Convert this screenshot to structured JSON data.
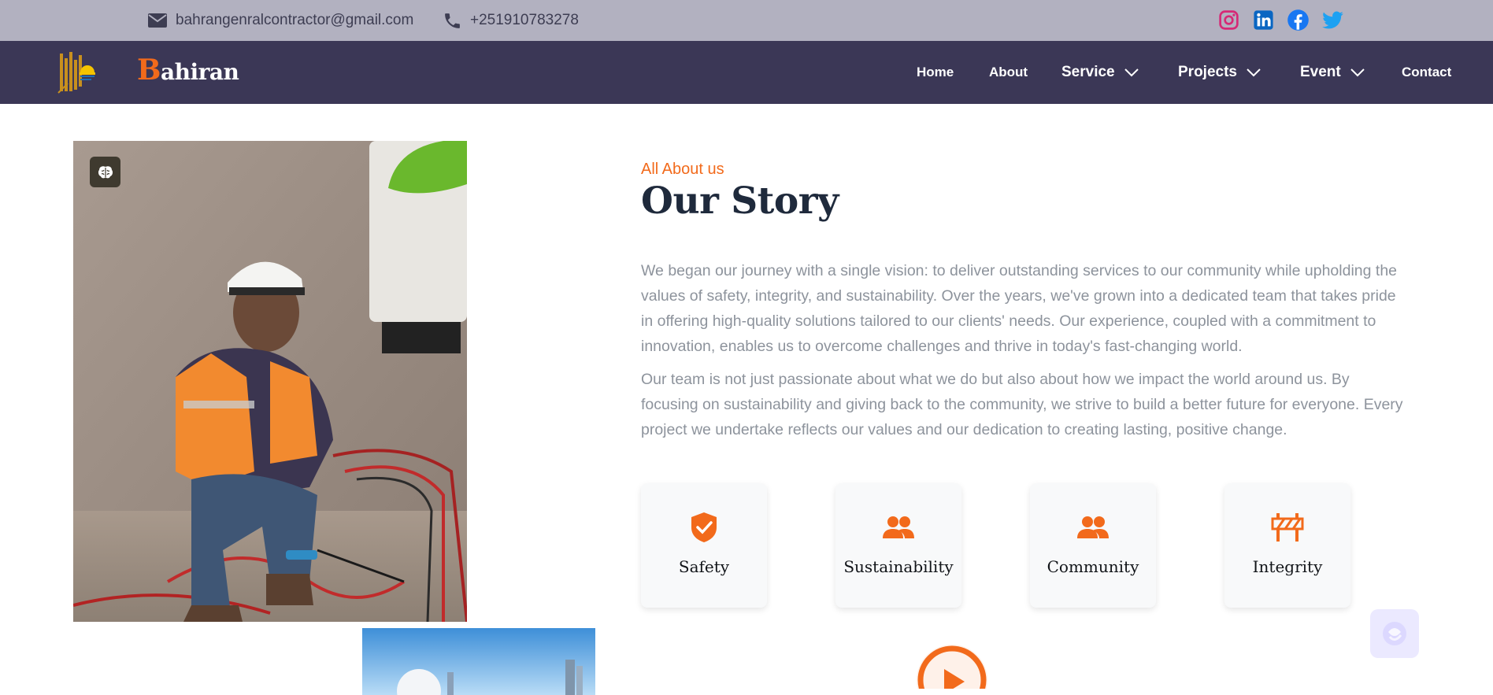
{
  "topbar": {
    "email": "bahrangenralcontractor@gmail.com",
    "phone": "+251910783278",
    "email_icon": "envelope-icon",
    "phone_icon": "phone-icon",
    "socials": [
      "instagram-icon",
      "linkedin-icon",
      "facebook-icon",
      "twitter-icon"
    ]
  },
  "nav": {
    "brand_initial": "B",
    "brand_rest": "ahiran",
    "items": [
      {
        "label": "Home"
      },
      {
        "label": "About"
      },
      {
        "label": "Service"
      },
      {
        "label": "Projects"
      },
      {
        "label": "Event"
      },
      {
        "label": "Contact"
      }
    ]
  },
  "about": {
    "eyebrow": "All About us",
    "title": "Our Story",
    "paragraph1": "We began our journey with a single vision: to deliver outstanding services to our community while upholding the values of safety, integrity, and sustainability. Over the years, we've grown into a dedicated team that takes pride in offering high-quality solutions tailored to our clients' needs. Our experience, coupled with a commitment to innovation, enables us to overcome challenges and thrive in today's fast-changing world.",
    "paragraph2": "Our team is not just passionate about what we do but also about how we impact the world around us. By focusing on sustainability and giving back to the community, we strive to build a better future for everyone. Every project we undertake reflects our values and our dedication to creating lasting, positive change.",
    "values": [
      {
        "label": "Safety",
        "icon": "shield-check-icon"
      },
      {
        "label": "Sustainability",
        "icon": "people-icon"
      },
      {
        "label": "Community",
        "icon": "people-icon"
      },
      {
        "label": "Integrity",
        "icon": "road-barrier-icon"
      }
    ]
  },
  "colors": {
    "accent": "#f26a1b",
    "nav_bg": "#3b3756",
    "topbar_bg": "#b2b1c0",
    "heading": "#1f2a3c",
    "body_text": "#8d939c"
  }
}
